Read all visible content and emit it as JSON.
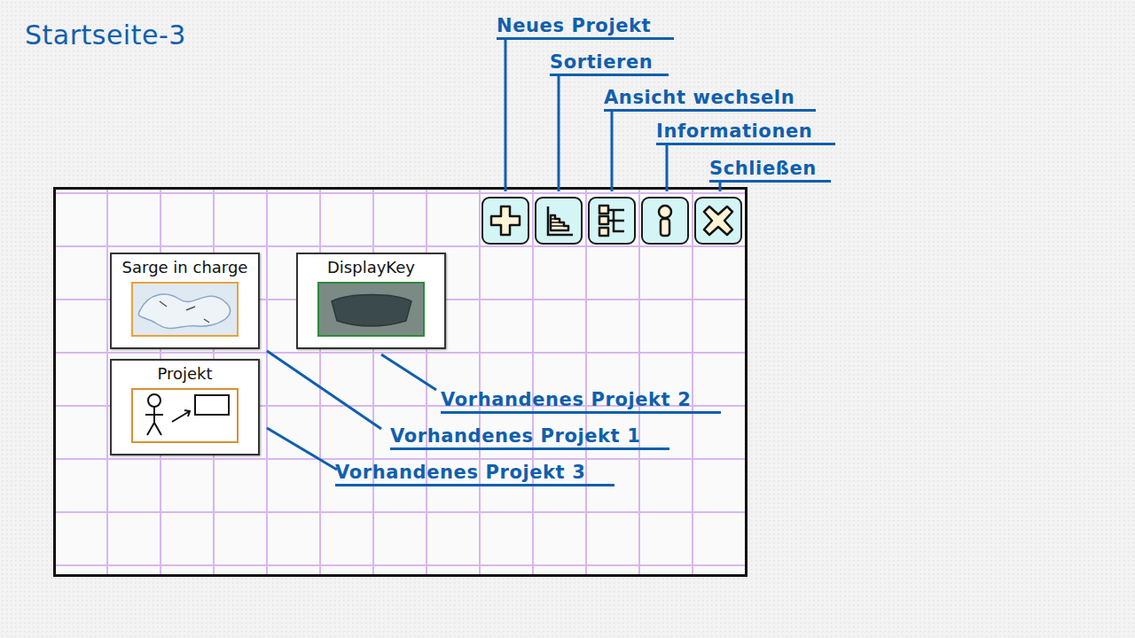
{
  "page": {
    "title": "Startseite-3"
  },
  "toolbar": [
    {
      "annotation": "Neues Projekt"
    },
    {
      "annotation": "Sortieren"
    },
    {
      "annotation": "Ansicht wechseln"
    },
    {
      "annotation": "Informationen"
    },
    {
      "annotation": "Schließen"
    }
  ],
  "projects": [
    {
      "name": "Sarge in charge",
      "annotation": "Vorhandenes Projekt 1"
    },
    {
      "name": "DisplayKey",
      "annotation": "Vorhandenes Projekt 2"
    },
    {
      "name": "Projekt",
      "annotation": "Vorhandenes Projekt 3"
    }
  ]
}
